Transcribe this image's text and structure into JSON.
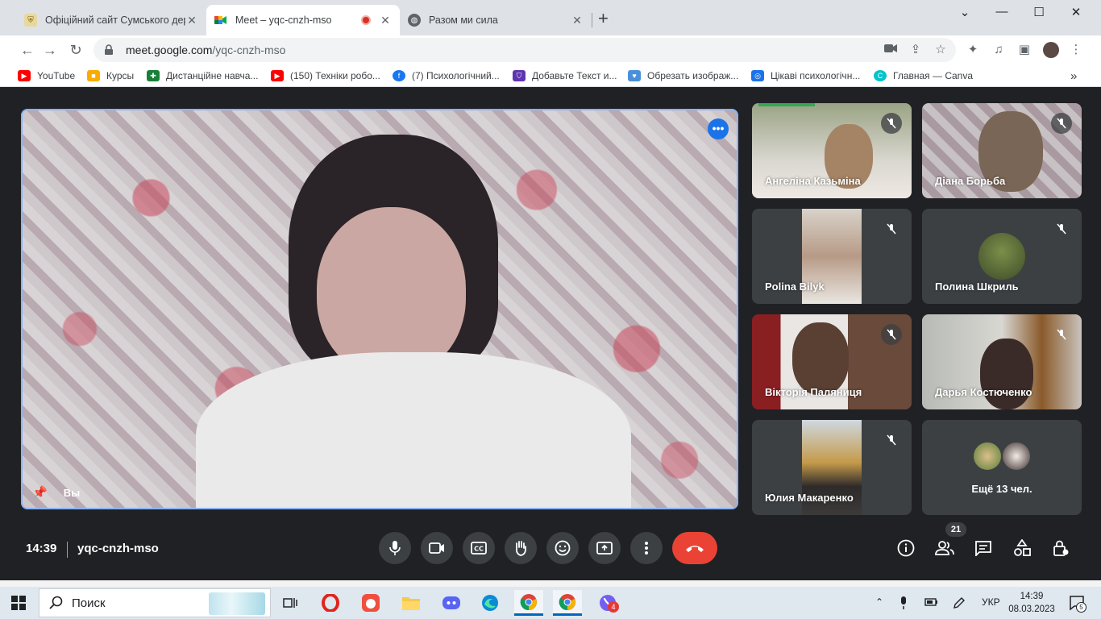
{
  "browser": {
    "tabs": [
      {
        "title": "Офіційний сайт Сумського держ",
        "active": false
      },
      {
        "title": "Meet – yqc-cnzh-mso",
        "active": true
      },
      {
        "title": "Разом ми сила",
        "active": false
      }
    ],
    "url": {
      "host": "meet.google.com",
      "path": "/yqc-cnzh-mso"
    }
  },
  "bookmarks": [
    {
      "label": "YouTube",
      "icon": "youtube-icon"
    },
    {
      "label": "Курсы",
      "icon": "classroom-icon"
    },
    {
      "label": "Дистанційне навча...",
      "icon": "classroom-green-icon"
    },
    {
      "label": "(150) Техніки робо...",
      "icon": "youtube-icon"
    },
    {
      "label": "(7) Психологічний...",
      "icon": "facebook-icon"
    },
    {
      "label": "Добавьте Текст и...",
      "icon": "shield-icon"
    },
    {
      "label": "Обрезать изображ...",
      "icon": "heart-icon"
    },
    {
      "label": "Цікаві психологічн...",
      "icon": "globe-icon"
    },
    {
      "label": "Главная — Canva",
      "icon": "canva-icon"
    }
  ],
  "meet": {
    "self_label": "Вы",
    "participants": [
      {
        "name": "Ангеліна Казьміна"
      },
      {
        "name": "Діана Борьба"
      },
      {
        "name": "Polina Bilyk"
      },
      {
        "name": "Полина Шкриль"
      },
      {
        "name": "Вікторія Паляниця"
      },
      {
        "name": "Дарья Костюченко"
      },
      {
        "name": "Юлия Макаренко"
      }
    ],
    "more_count": "Ещё 13 чел.",
    "time": "14:39",
    "meeting_code": "yqc-cnzh-mso",
    "people_count": "21"
  },
  "taskbar": {
    "search_placeholder": "Поиск",
    "lang": "УКР",
    "clock_time": "14:39",
    "clock_date": "08.03.2023",
    "viber_badge": "4",
    "notif_count": "5"
  },
  "colors": {
    "meet_bg": "#202124",
    "hangup": "#ea4335",
    "active_border": "#8ab4f8",
    "accent_blue": "#1a73e8"
  }
}
